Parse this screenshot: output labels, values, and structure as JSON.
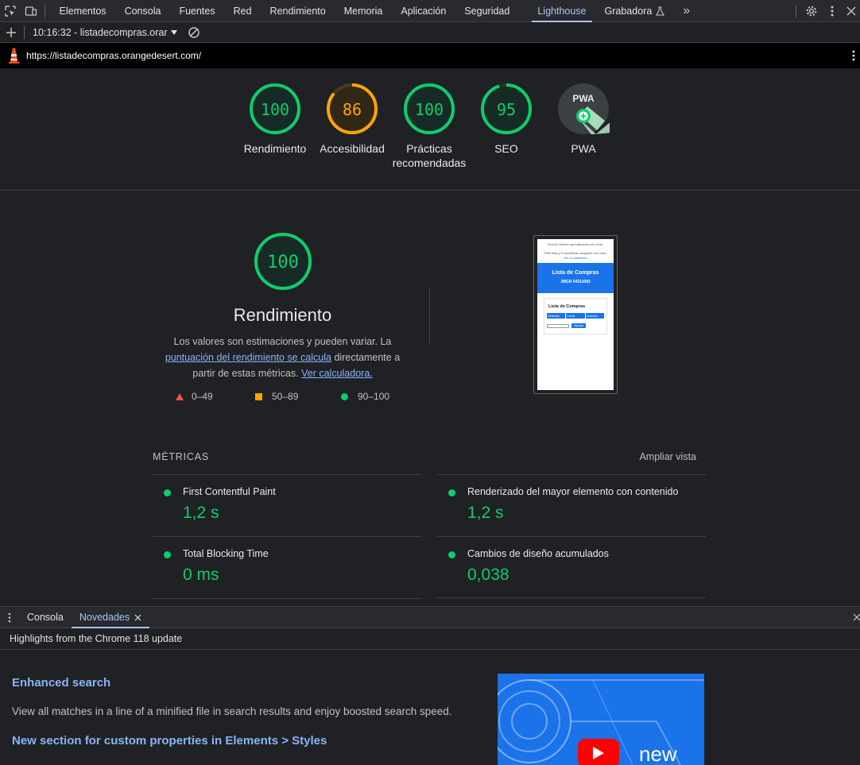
{
  "toolbar": {
    "tabs": [
      "Elementos",
      "Consola",
      "Fuentes",
      "Red",
      "Rendimiento",
      "Memoria",
      "Aplicación",
      "Seguridad",
      "Lighthouse",
      "Grabadora"
    ],
    "active_tab": "Lighthouse",
    "more_tabs": "»"
  },
  "session": {
    "report_label": "10:16:32 - listadecompras.orar"
  },
  "url": "https://listadecompras.orangedesert.com/",
  "categories": [
    {
      "label": "Rendimiento",
      "score": "100",
      "value": 100,
      "color": "#0cce6b"
    },
    {
      "label": "Accesibilidad",
      "score": "86",
      "value": 86,
      "color": "#ffa400"
    },
    {
      "label": "Prácticas recomendadas",
      "score": "100",
      "value": 100,
      "color": "#0cce6b"
    },
    {
      "label": "SEO",
      "score": "95",
      "value": 95,
      "color": "#0cce6b"
    },
    {
      "label": "PWA",
      "score": "PWA",
      "color": "#0cce6b"
    }
  ],
  "performance": {
    "score": "100",
    "title": "Rendimiento",
    "desc_1": "Los valores son estimaciones y pueden variar. La ",
    "link_1": "puntuación del rendimiento se calcula",
    "desc_2": " directamente a partir de estas métricas. ",
    "link_2": "Ver calculadora.",
    "legend": [
      {
        "range": "0–49",
        "color": "#ff4e42"
      },
      {
        "range": "50–89",
        "color": "#ffa400"
      },
      {
        "range": "90–100",
        "color": "#0cce6b"
      }
    ]
  },
  "screenshot": {
    "line1": "Service Worker ejecutándose con éxito.",
    "line2": "PWA lista y el manifiesto cargados con éxito.",
    "line3": "Ver el manifiesto",
    "header_title": "Lista de Compras",
    "header_sub": "JMGR 04311082",
    "card_title": "Lista de Compras",
    "col1": "Elemento",
    "col2": "Fecha",
    "col3": "Acciones",
    "button": "Agregar"
  },
  "metrics": {
    "heading": "MÉTRICAS",
    "expand": "Ampliar vista",
    "items": [
      {
        "title": "First Contentful Paint",
        "value": "1,2 s"
      },
      {
        "title": "Renderizado del mayor elemento con contenido",
        "value": "1,2 s"
      },
      {
        "title": "Total Blocking Time",
        "value": "0 ms"
      },
      {
        "title": "Cambios de diseño acumulados",
        "value": "0,038"
      }
    ]
  },
  "drawer": {
    "tabs": [
      "Consola",
      "Novedades"
    ],
    "active": "Novedades",
    "highlights": "Highlights from the Chrome 118 update",
    "news": [
      {
        "title": "Enhanced search",
        "desc": "View all matches in a line of a minified file in search results and enjoy boosted search speed."
      },
      {
        "title": "New section for custom properties in Elements > Styles"
      }
    ],
    "video_text": "new"
  }
}
